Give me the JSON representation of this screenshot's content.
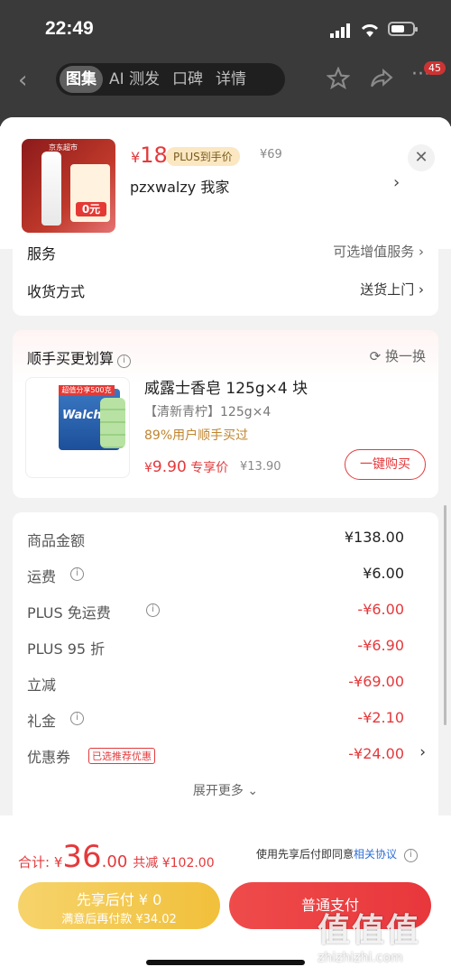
{
  "status": {
    "time": "22:49"
  },
  "nav": {
    "tabs": [
      "图集",
      "AI 测发",
      "口碑",
      "详情"
    ],
    "badge": "45"
  },
  "product": {
    "currency": "¥",
    "price": "18",
    "plus_tag": "PLUS到手价",
    "orig_price": "¥69",
    "address": "pzxwalzy  我家",
    "thumb_brand": "京东超市",
    "thumb_zero": "0元"
  },
  "service": {
    "label": "服务",
    "value": "可选增值服务",
    "delivery_label": "收货方式",
    "delivery_value": "送货上门"
  },
  "together": {
    "title": "顺手买更划算",
    "swap": "换一换",
    "name": "威露士香皂 125g×4 块",
    "spec": "【清新青柠】125g×4",
    "rate": "89%用户顺手买过",
    "price_symbol": "¥",
    "price": "9.90",
    "price_note": "专享价",
    "orig": "¥13.90",
    "button": "一键购买",
    "img_brand": "Walch",
    "img_ribbon": "超值分享500克"
  },
  "amounts": [
    {
      "key": "商品金额",
      "value": "¥138.00",
      "info": false,
      "red": false
    },
    {
      "key": "运费",
      "value": "¥6.00",
      "info": true,
      "red": false
    },
    {
      "key": "PLUS 免运费",
      "value": "-¥6.00",
      "info": true,
      "red": true
    },
    {
      "key": "PLUS 95 折",
      "value": "-¥6.90",
      "info": false,
      "red": true
    },
    {
      "key": "立减",
      "value": "-¥69.00",
      "info": false,
      "red": true
    },
    {
      "key": "礼金",
      "value": "-¥2.10",
      "info": true,
      "red": true
    },
    {
      "key": "优惠券",
      "value": "-¥24.00",
      "info": false,
      "red": true,
      "tag": "已选推荐优惠"
    }
  ],
  "more": "展开更多 ⌄",
  "footer": {
    "total_label": "合计: ¥",
    "total_int": "36",
    "total_dec": ".00",
    "discount": "共减 ¥102.00",
    "agree_text": "使用先享后付即同意",
    "agree_link": "相关协议",
    "later_line1": "先享后付 ¥ 0",
    "later_line2": "满意后再付款 ¥34.02",
    "pay": "普通支付"
  },
  "watermark": {
    "logo": "值值值",
    "url": "zhizhizhi.com"
  }
}
